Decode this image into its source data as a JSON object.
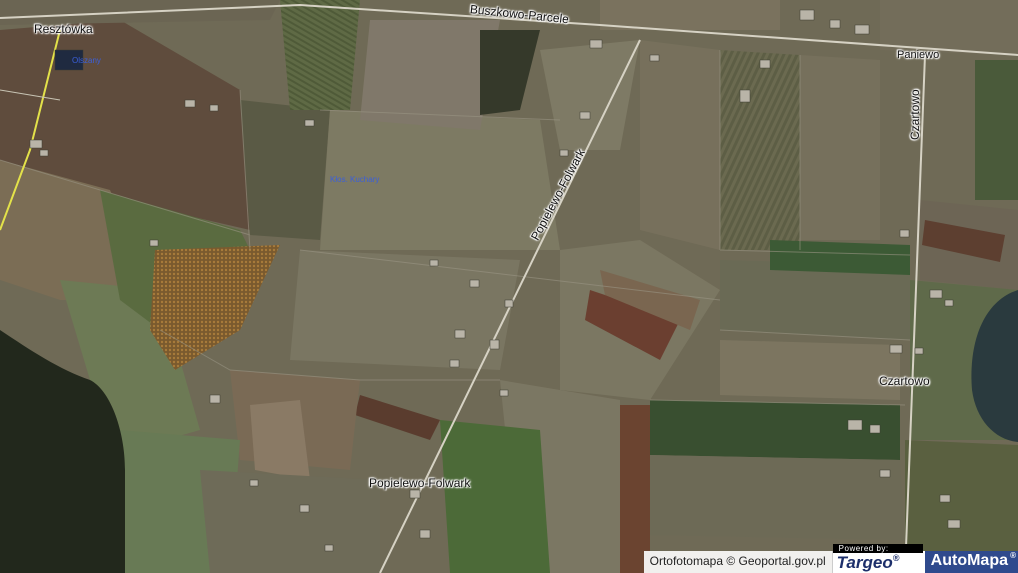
{
  "places": {
    "resztowka": "Resztówka",
    "buszkowo_parcele": "Buszkowo-Parcele",
    "paniewo": "Paniewo",
    "czartowo_road": "Czartowo",
    "popielewo_folwark_road": "Popielewo-Folwark",
    "czartowo": "Czartowo",
    "popielewo_folwark": "Popielewo-Folwark",
    "blue_label_1": "Olszany",
    "blue_label_2": "Kłos. Kuchary"
  },
  "attribution": {
    "text": "Ortofotomapa © Geoportal.gov.pl",
    "powered_by": "Powered by:",
    "targeo": "Targeo",
    "automapa": "AutoMapa",
    "registered": "®"
  },
  "colors": {
    "road": "#d6d2c4",
    "main_road": "#e3e24a",
    "forest": "#22281c",
    "lake": "#2a3a3e",
    "automapa_bg": "#2f4a8d"
  }
}
